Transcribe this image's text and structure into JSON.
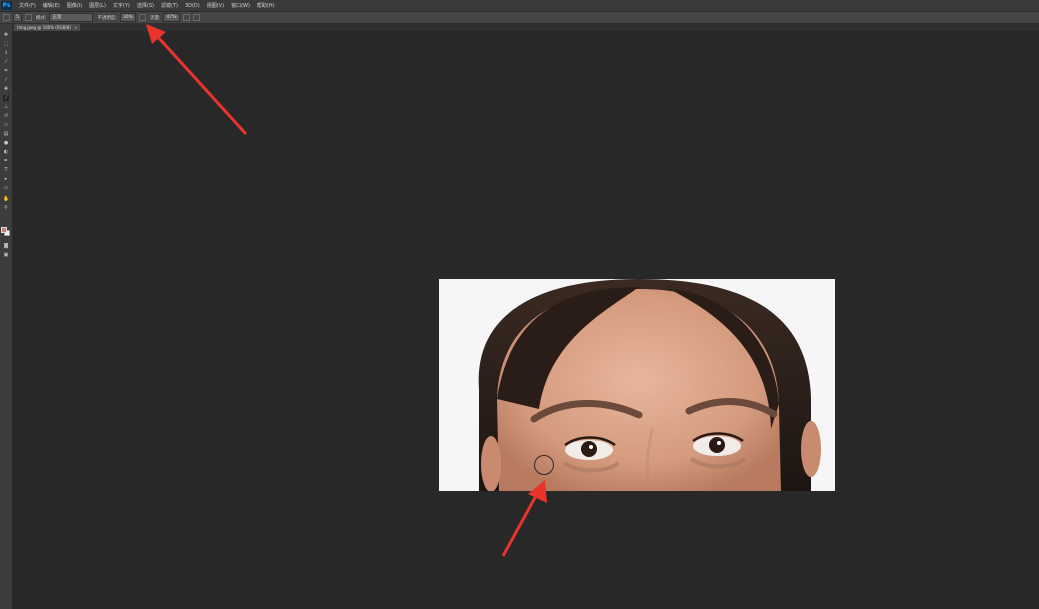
{
  "app": {
    "logo": "Ps"
  },
  "menubar": {
    "items": [
      "文件(F)",
      "编辑(E)",
      "图像(I)",
      "图层(L)",
      "文字(Y)",
      "选择(S)",
      "滤镜(T)",
      "3D(D)",
      "视图(V)",
      "窗口(W)",
      "帮助(H)"
    ]
  },
  "options": {
    "brush_size": "5",
    "mode_label": "模式:",
    "mode_value": "正常",
    "opacity_label": "不透明度:",
    "opacity_value": "30%",
    "flow_label": "流量:",
    "flow_value": "47%"
  },
  "document": {
    "tab_title": "timg.jpeg @ 100% (RGB/8)",
    "close_glyph": "×"
  },
  "tools": [
    "move-icon",
    "marquee-icon",
    "lasso-icon",
    "quick-select-icon",
    "crop-icon",
    "eyedropper-icon",
    "healing-icon",
    "brush-icon",
    "clone-stamp-icon",
    "history-brush-icon",
    "eraser-icon",
    "gradient-icon",
    "blur-icon",
    "dodge-icon",
    "pen-icon",
    "type-icon",
    "path-select-icon",
    "rectangle-icon",
    "hand-icon",
    "zoom-icon"
  ],
  "colors": {
    "foreground": "#c87f74",
    "background": "#f4f4f4",
    "annotation_arrow": "#e8342c",
    "workspace": "#282828"
  }
}
